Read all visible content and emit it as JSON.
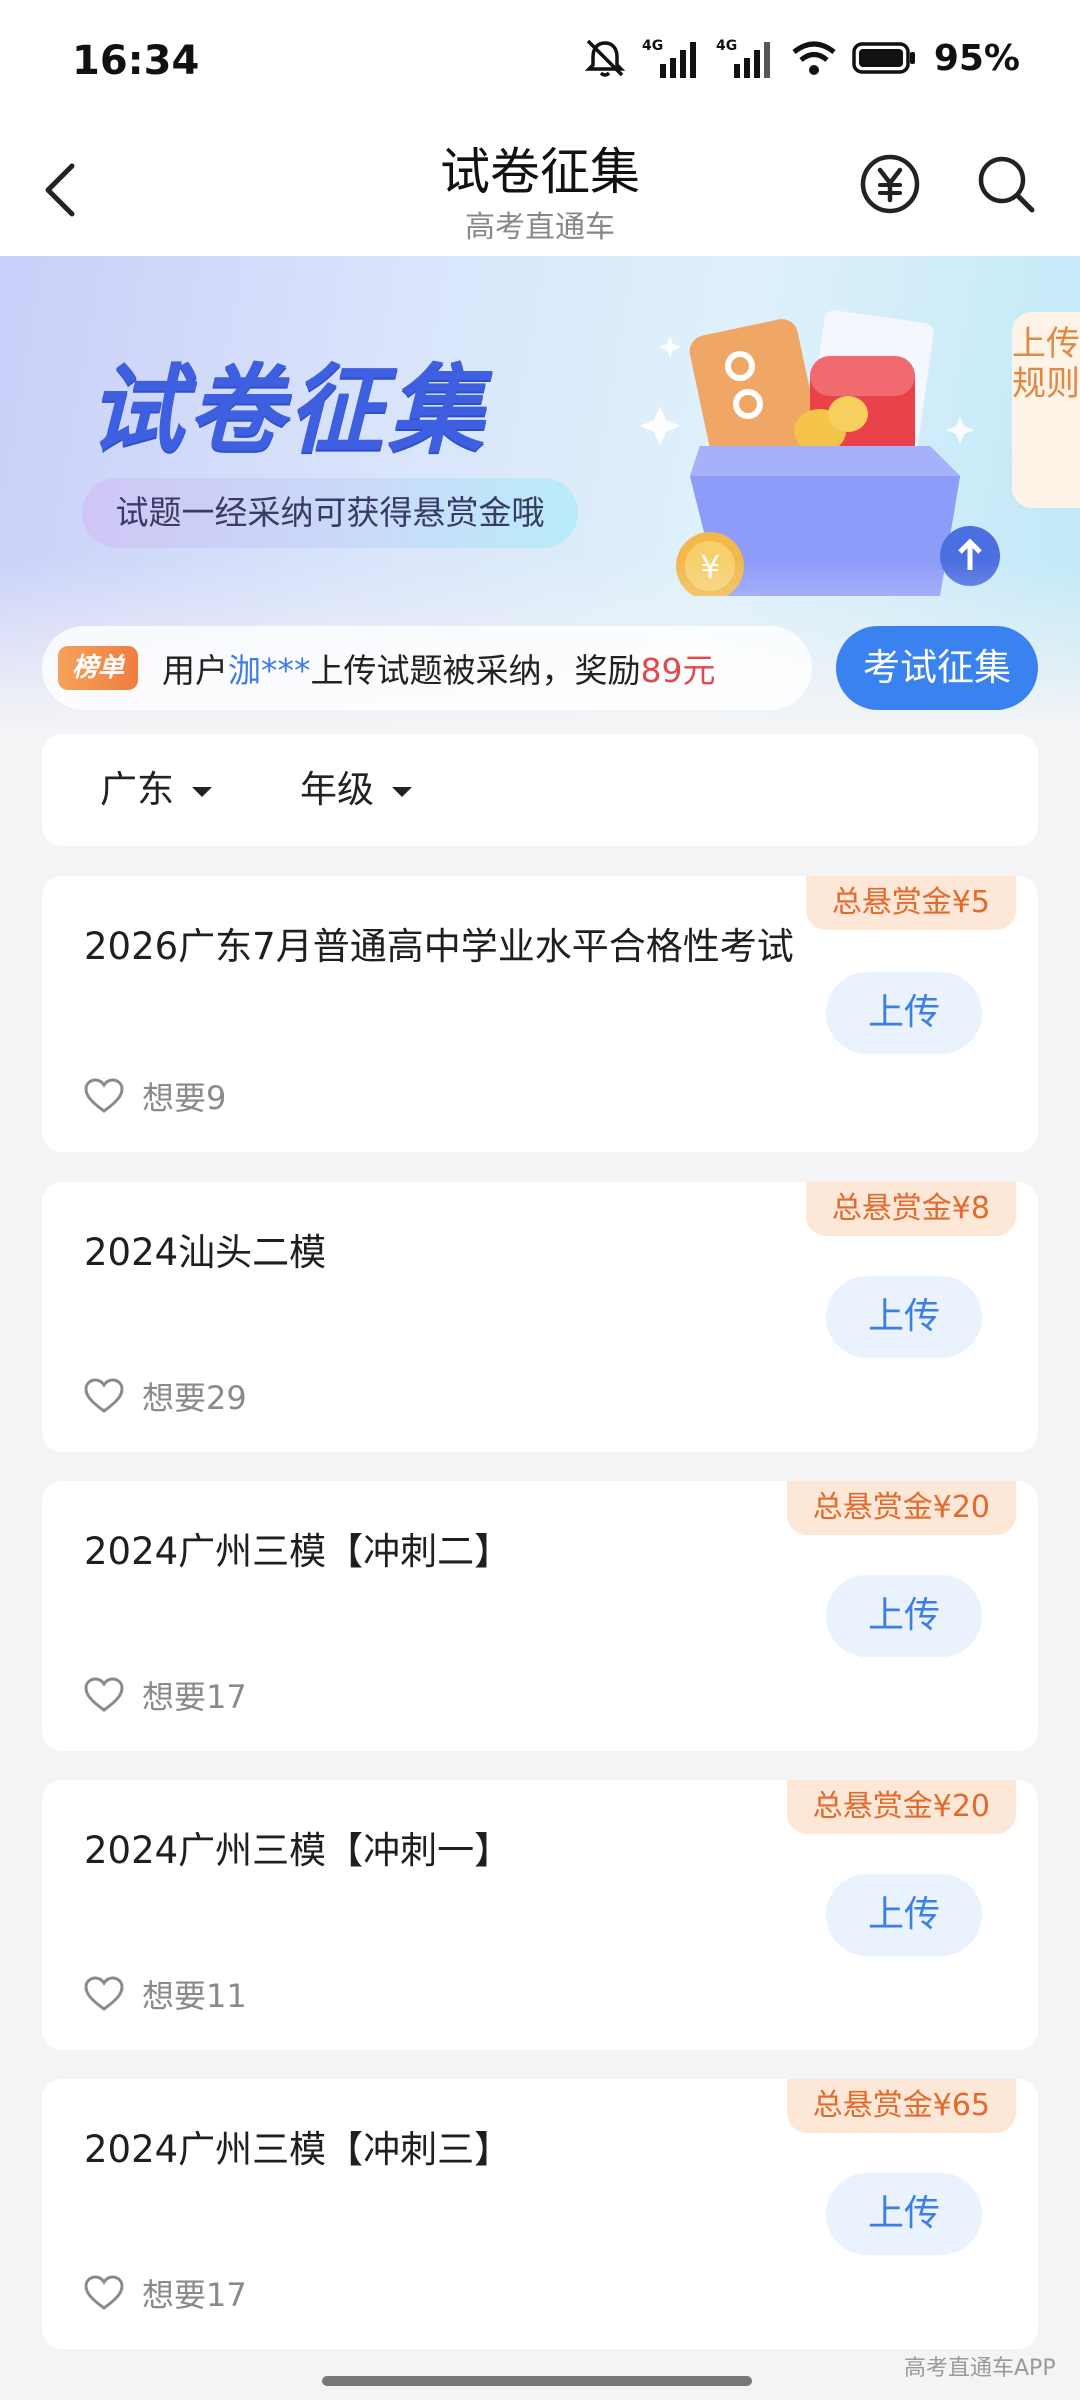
{
  "status_bar": {
    "time": "16:34",
    "battery": "95%"
  },
  "nav": {
    "title": "试卷征集",
    "subtitle": "高考直通车"
  },
  "banner": {
    "title": "试卷征集",
    "tagline": "试题一经采纳可获得悬赏金哦",
    "rules_tab": "上传规则"
  },
  "ticker": {
    "badge": "榜单",
    "prefix": "用户",
    "user": "泇***",
    "middle": "上传试题被采纳，奖励",
    "reward": "89元"
  },
  "exam_button": "考试征集",
  "filters": [
    {
      "label": "广东"
    },
    {
      "label": "年级"
    }
  ],
  "cards": [
    {
      "title": "2026广东7月普通高中学业水平合格性考试",
      "bounty": "总悬赏金¥5",
      "upload": "上传",
      "want": "想要9"
    },
    {
      "title": "2024汕头二模",
      "bounty": "总悬赏金¥8",
      "upload": "上传",
      "want": "想要29"
    },
    {
      "title": "2024广州三模【冲刺二】",
      "bounty": "总悬赏金¥20",
      "upload": "上传",
      "want": "想要17"
    },
    {
      "title": "2024广州三模【冲刺一】",
      "bounty": "总悬赏金¥20",
      "upload": "上传",
      "want": "想要11"
    },
    {
      "title": "2024广州三模【冲刺三】",
      "bounty": "总悬赏金¥65",
      "upload": "上传",
      "want": "想要17"
    }
  ],
  "watermark": "高考直通车APP",
  "colors": {
    "accent": "#3b82f1",
    "bounty_text": "#e26a2c",
    "reward": "#e14a4a"
  }
}
